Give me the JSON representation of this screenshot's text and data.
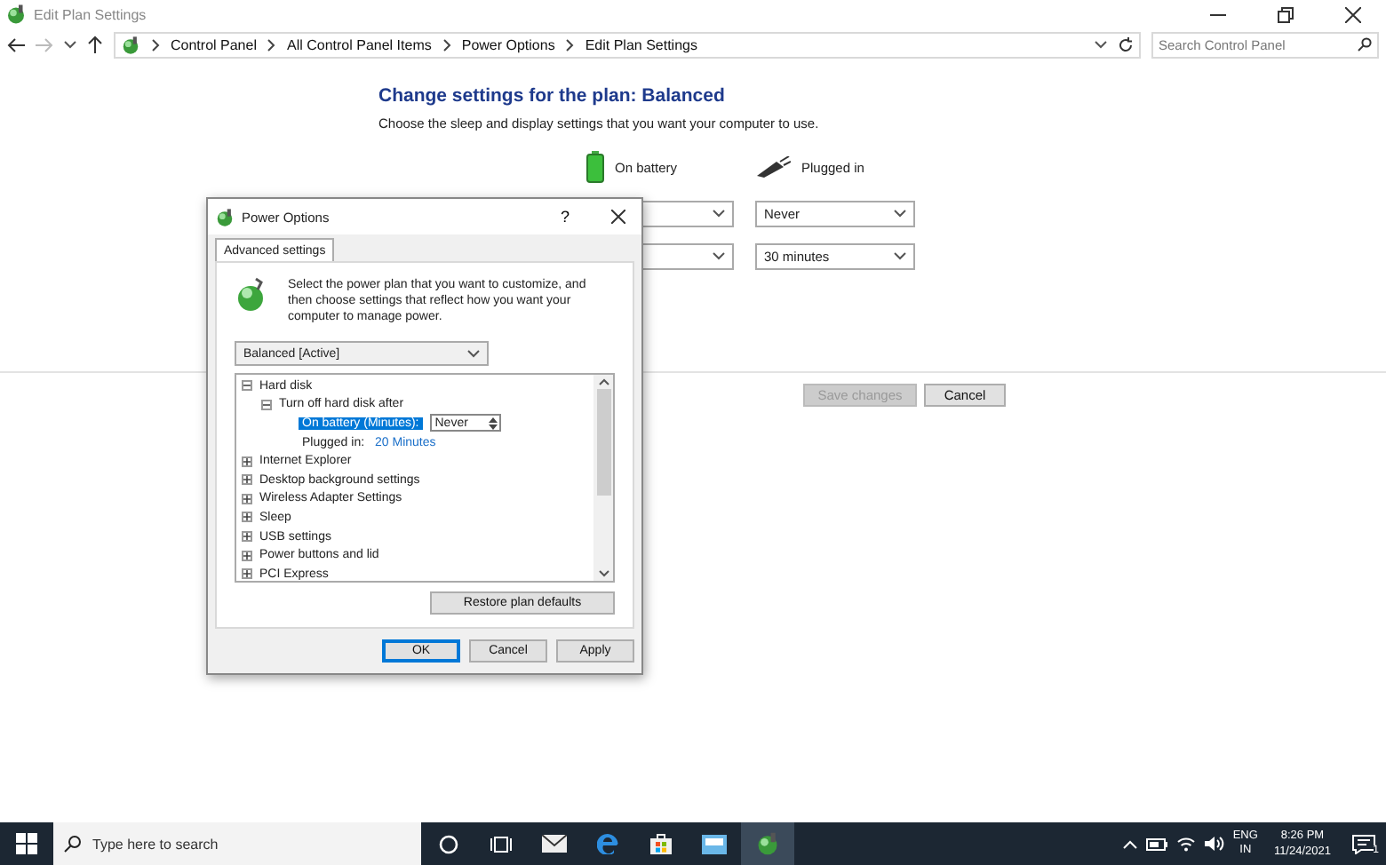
{
  "window": {
    "title": "Edit Plan Settings"
  },
  "address_bar": {
    "breadcrumbs": [
      "Control Panel",
      "All Control Panel Items",
      "Power Options",
      "Edit Plan Settings"
    ],
    "search": {
      "placeholder": "Search Control Panel"
    }
  },
  "content": {
    "heading": "Change settings for the plan: Balanced",
    "subtitle": "Choose the sleep and display settings that you want your computer to use.",
    "columns": [
      {
        "label": "On battery",
        "kind": "battery"
      },
      {
        "label": "Plugged in",
        "kind": "plug"
      }
    ],
    "rows": [
      {
        "plugged_in": "Never"
      },
      {
        "plugged_in": "30 minutes"
      }
    ],
    "buttons": [
      {
        "label": "Save changes",
        "disabled": true
      },
      {
        "label": "Cancel",
        "disabled": false
      }
    ]
  },
  "dialog": {
    "title": "Power Options",
    "help": "?",
    "tabs": [
      {
        "label": "Advanced settings",
        "selected": true
      }
    ],
    "description": "Select the power plan that you want to customize, and then choose settings that reflect how you want your computer to manage power.",
    "plan_select": "Balanced [Active]",
    "tree": [
      {
        "label": "Hard disk",
        "expanded": true,
        "children": [
          {
            "label": "Turn off hard disk after",
            "expanded": true,
            "children": [
              {
                "kind": "setting",
                "label": "On battery (Minutes):",
                "value": "Never",
                "selected": true
              },
              {
                "kind": "setting",
                "label": "Plugged in:",
                "value": "20 Minutes",
                "selected": false
              }
            ]
          }
        ]
      },
      {
        "label": "Internet Explorer",
        "expanded": false
      },
      {
        "label": "Desktop background settings",
        "expanded": false
      },
      {
        "label": "Wireless Adapter Settings",
        "expanded": false
      },
      {
        "label": "Sleep",
        "expanded": false
      },
      {
        "label": "USB settings",
        "expanded": false
      },
      {
        "label": "Power buttons and lid",
        "expanded": false
      },
      {
        "label": "PCI Express",
        "expanded": false
      }
    ],
    "restore_button": "Restore plan defaults",
    "buttons": [
      {
        "label": "OK",
        "default": true
      },
      {
        "label": "Cancel",
        "default": false
      },
      {
        "label": "Apply",
        "default": false
      }
    ]
  },
  "taskbar": {
    "search": {
      "placeholder": "Type here to search"
    },
    "language": "ENG",
    "region": "IN",
    "time": "8:26 PM",
    "date": "11/24/2021",
    "notifications": "1"
  }
}
